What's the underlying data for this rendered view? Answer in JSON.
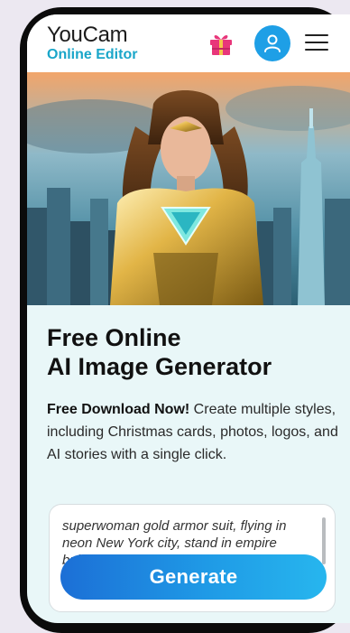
{
  "header": {
    "logo_line1": "YouCam",
    "logo_line2": "Online Editor",
    "icons": [
      "gift-icon",
      "user-icon",
      "menu-icon"
    ]
  },
  "hero": {
    "image": "ai-generated-superhero-woman-gold-armor-city-skyline"
  },
  "main": {
    "title_line1": "Free Online",
    "title_line2": "AI Image Generator",
    "desc_bold": "Free Download Now!",
    "desc_rest": " Create multiple styles, including Christmas cards, photos, logos, and AI stories with a single click.",
    "prompt_value": "superwoman gold armor suit, flying in neon New York city, stand in empire building, fashion|",
    "generate_label": "Generate"
  },
  "colors": {
    "accent": "#1e9fe6",
    "brand_text": "#1aa6c9",
    "gift": "#e8367a"
  }
}
